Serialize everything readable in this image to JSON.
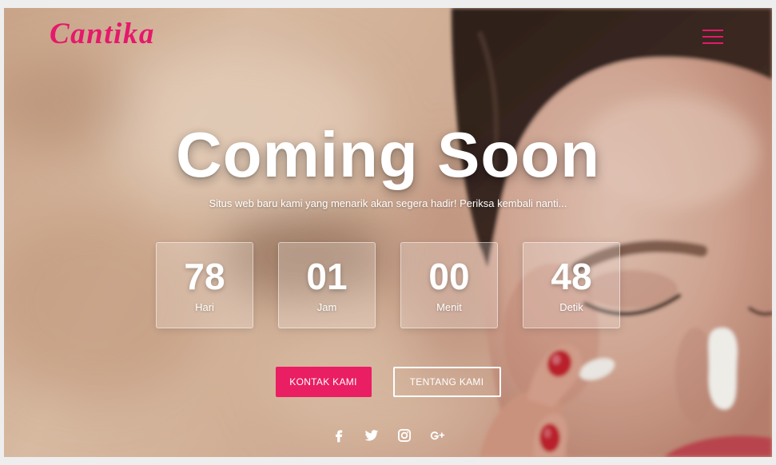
{
  "brand": {
    "logo_text": "Cantika",
    "accent_color": "#e91e63"
  },
  "nav": {
    "menu_icon": "hamburger-menu-icon"
  },
  "hero": {
    "title": "Coming Soon",
    "subtitle": "Situs web baru kami yang menarik akan segera hadir! Periksa kembali nanti...",
    "text_color": "#ffffff"
  },
  "countdown": [
    {
      "value": "78",
      "label": "Hari"
    },
    {
      "value": "01",
      "label": "Jam"
    },
    {
      "value": "00",
      "label": "Menit"
    },
    {
      "value": "48",
      "label": "Detik"
    }
  ],
  "buttons": {
    "contact_label": "KONTAK KAMI",
    "about_label": "TENTANG KAMI"
  },
  "social": [
    {
      "icon": "facebook-icon"
    },
    {
      "icon": "twitter-icon"
    },
    {
      "icon": "instagram-icon"
    },
    {
      "icon": "google-plus-icon"
    }
  ]
}
